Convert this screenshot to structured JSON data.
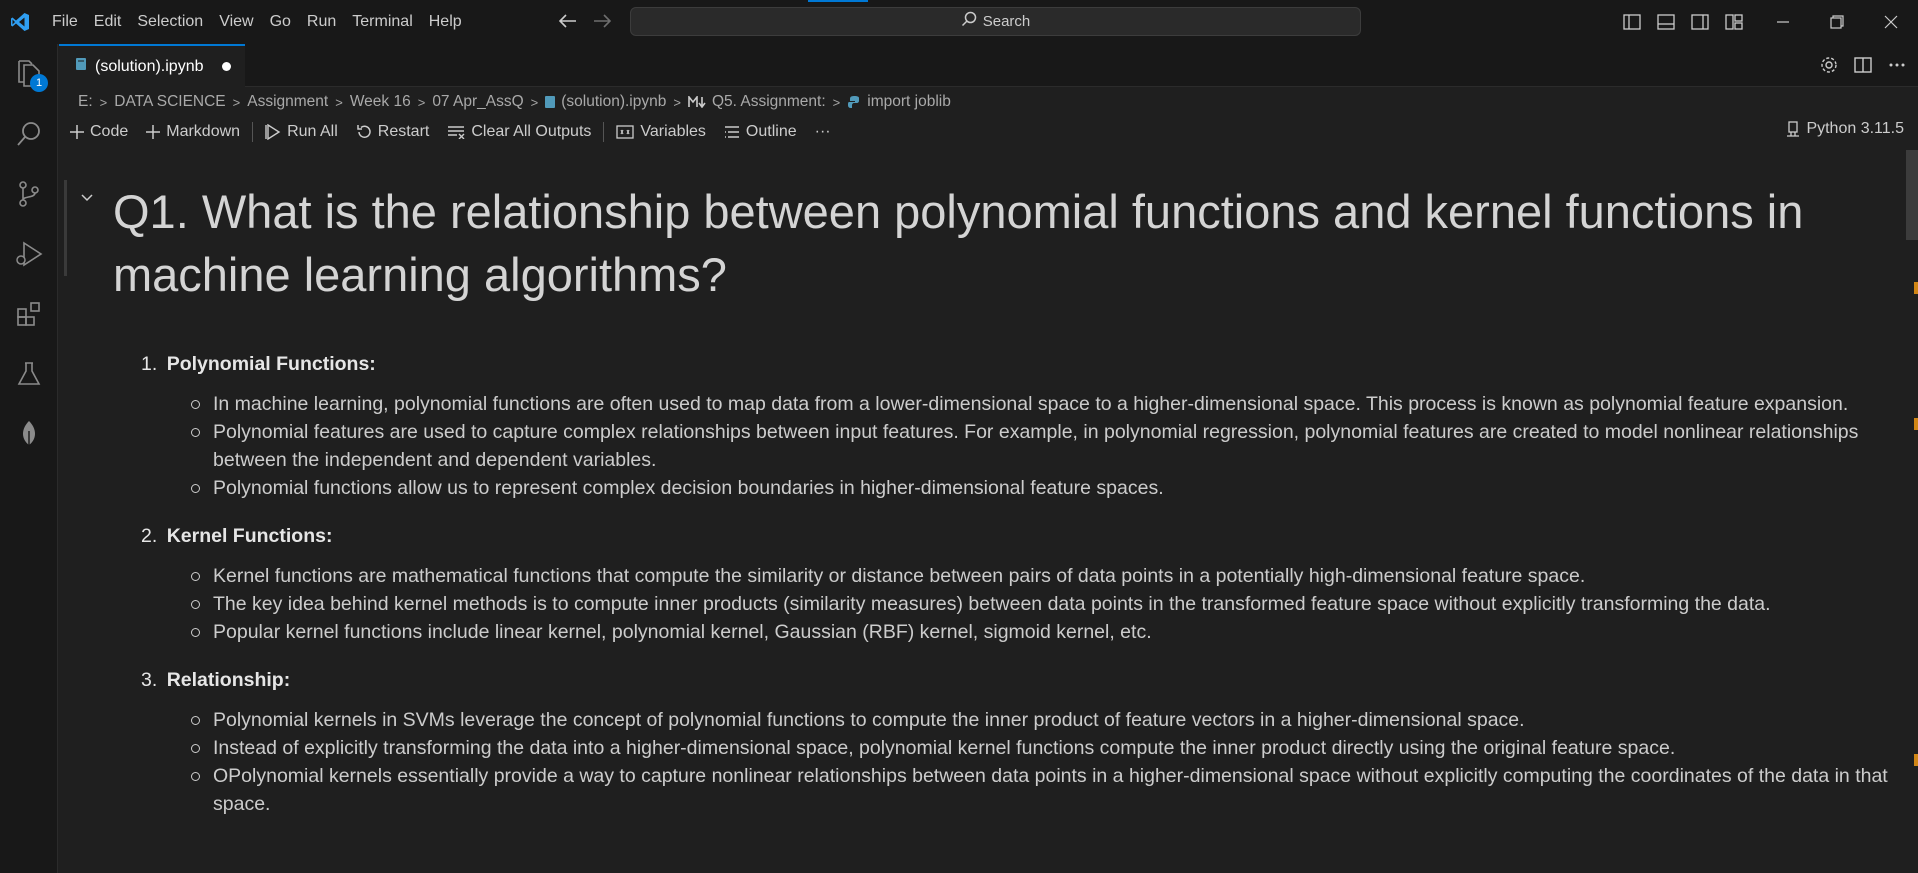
{
  "titlebar": {
    "menu": [
      "File",
      "Edit",
      "Selection",
      "View",
      "Go",
      "Run",
      "Terminal",
      "Help"
    ],
    "search_placeholder": "Search"
  },
  "activitybar": {
    "explorer_badge": "1"
  },
  "tab": {
    "label": "(solution).ipynb"
  },
  "breadcrumb": [
    "E:",
    "DATA SCIENCE",
    "Assignment",
    "Week 16",
    "07 Apr_AssQ",
    "(solution).ipynb",
    "Q5. Assignment:",
    "import joblib"
  ],
  "toolbar": {
    "code": "Code",
    "markdown": "Markdown",
    "run_all": "Run All",
    "restart": "Restart",
    "clear_outputs": "Clear All Outputs",
    "variables": "Variables",
    "outline": "Outline",
    "more": "···",
    "kernel": "Python 3.11.5"
  },
  "cell": {
    "heading": "Q1. What is the relationship between polynomial functions and kernel functions in machine learning algorithms?",
    "items": [
      {
        "number": "1.",
        "title": "Polynomial Functions:",
        "bullets": [
          "In machine learning, polynomial functions are often used to map data from a lower-dimensional space to a higher-dimensional space. This process is known as polynomial feature expansion.",
          "Polynomial features are used to capture complex relationships between input features. For example, in polynomial regression, polynomial features are created to model nonlinear relationships between the independent and dependent variables.",
          "Polynomial functions allow us to represent complex decision boundaries in higher-dimensional feature spaces."
        ]
      },
      {
        "number": "2.",
        "title": "Kernel Functions:",
        "bullets": [
          "Kernel functions are mathematical functions that compute the similarity or distance between pairs of data points in a potentially high-dimensional feature space.",
          "The key idea behind kernel methods is to compute inner products (similarity measures) between data points in the transformed feature space without explicitly transforming the data.",
          "Popular kernel functions include linear kernel, polynomial kernel, Gaussian (RBF) kernel, sigmoid kernel, etc."
        ]
      },
      {
        "number": "3.",
        "title": "Relationship:",
        "bullets": [
          "Polynomial kernels in SVMs leverage the concept of polynomial functions to compute the inner product of feature vectors in a higher-dimensional space.",
          "Instead of explicitly transforming the data into a higher-dimensional space, polynomial kernel functions compute the inner product directly using the original feature space.",
          "OPolynomial kernels essentially provide a way to capture nonlinear relationships between data points in a higher-dimensional space without explicitly computing the coordinates of the data in that space."
        ]
      }
    ]
  },
  "colors": {
    "accent": "#0078d4",
    "background": "#1f1f1f",
    "chrome": "#181818"
  }
}
